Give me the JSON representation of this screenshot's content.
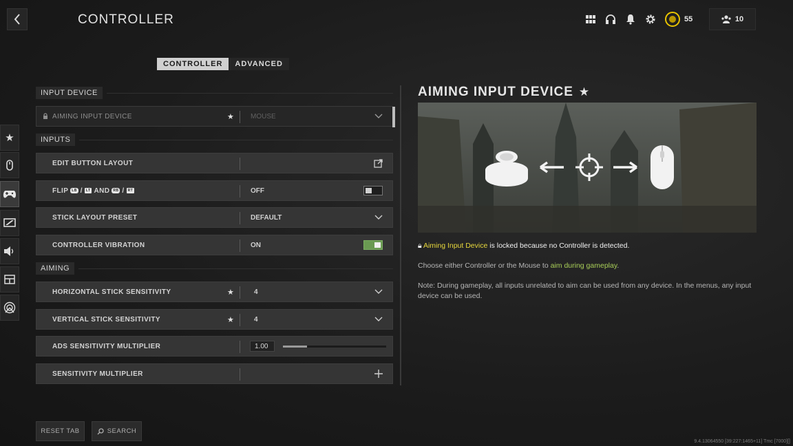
{
  "header": {
    "title": "CONTROLLER",
    "rank_value": "55",
    "friends_count": "10"
  },
  "tabs": [
    {
      "label": "CONTROLLER",
      "active": true
    },
    {
      "label": "ADVANCED",
      "active": false
    }
  ],
  "sidenav": [
    "star-icon",
    "mouse-icon",
    "gamepad-icon",
    "display-icon",
    "speaker-icon",
    "interface-icon",
    "network-icon"
  ],
  "sections": {
    "input_device": "INPUT DEVICE",
    "inputs": "INPUTS",
    "aiming": "AIMING"
  },
  "rows": {
    "aiming_input_device": {
      "label": "AIMING INPUT DEVICE",
      "value": "MOUSE"
    },
    "edit_button_layout": {
      "label": "EDIT BUTTON LAYOUT"
    },
    "flip": {
      "label_prefix": "FLIP",
      "and": "AND",
      "lb": "LB",
      "lt": "LT",
      "rb": "RB",
      "rt": "RT",
      "value": "OFF"
    },
    "stick_layout_preset": {
      "label": "STICK LAYOUT PRESET",
      "value": "DEFAULT"
    },
    "controller_vibration": {
      "label": "CONTROLLER VIBRATION",
      "value": "ON"
    },
    "horizontal_stick_sensitivity": {
      "label": "HORIZONTAL STICK SENSITIVITY",
      "value": "4"
    },
    "vertical_stick_sensitivity": {
      "label": "VERTICAL STICK SENSITIVITY",
      "value": "4"
    },
    "ads_sensitivity_multiplier": {
      "label": "ADS SENSITIVITY MULTIPLIER",
      "value": "1.00",
      "slider_fraction": 0.23
    },
    "sensitivity_multiplier": {
      "label": "SENSITIVITY MULTIPLIER"
    }
  },
  "detail": {
    "title": "AIMING INPUT DEVICE",
    "locked_highlight": "Aiming Input Device",
    "locked_text": " is locked because no Controller is detected.",
    "choose_text": "Choose either Controller or the Mouse to ",
    "choose_highlight": "aim during gameplay",
    "choose_end": ".",
    "note": "Note: During gameplay, all inputs unrelated to aim can be used from any device. In the menus, any input device can be used."
  },
  "bottom": {
    "reset_tab": "RESET TAB",
    "search": "SEARCH"
  },
  "version": "9.4.13064550 [39:227:1465+11] Tmc [7000][]",
  "colors": {
    "accent_yellow": "#e8d83c",
    "accent_green": "#a9cf58",
    "toggle_on": "#6a9a52"
  }
}
